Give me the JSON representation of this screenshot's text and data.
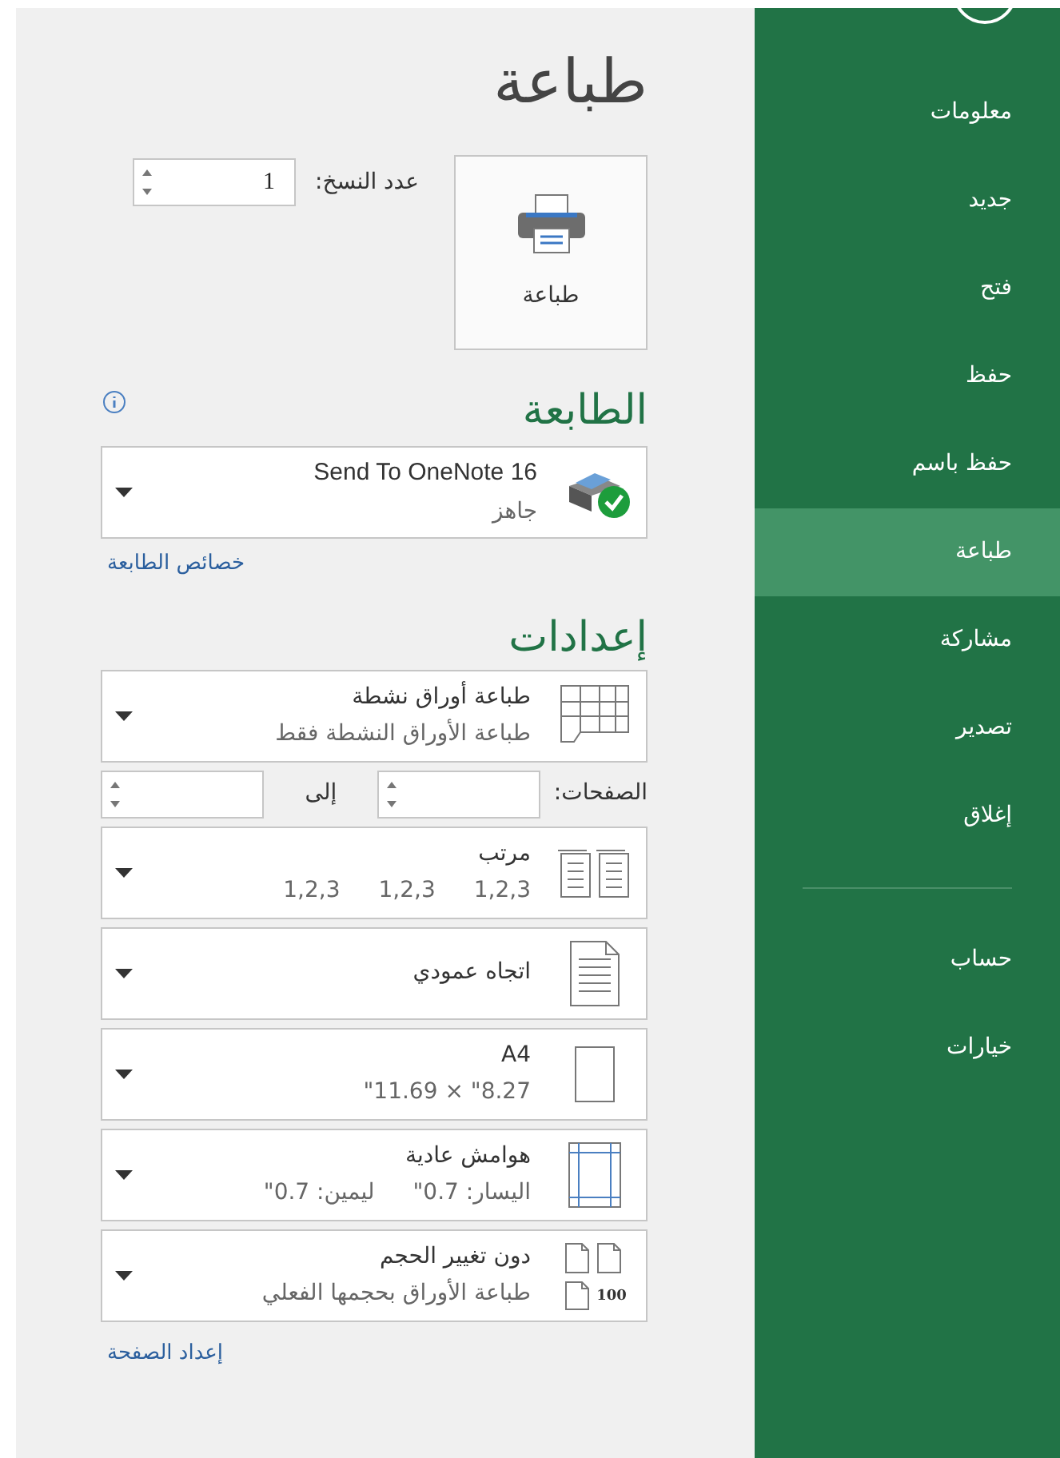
{
  "sidebar": {
    "items": [
      {
        "label": "معلومات",
        "selected": false
      },
      {
        "label": "جديد",
        "selected": false
      },
      {
        "label": "فتح",
        "selected": false
      },
      {
        "label": "حفظ",
        "selected": false
      },
      {
        "label": "حفظ باسم",
        "selected": false
      },
      {
        "label": "طباعة",
        "selected": true
      },
      {
        "label": "مشاركة",
        "selected": false
      },
      {
        "label": "تصدير",
        "selected": false
      },
      {
        "label": "إغلاق",
        "selected": false
      }
    ],
    "bottom_items": [
      {
        "label": "حساب",
        "selected": false
      },
      {
        "label": "خيارات",
        "selected": false
      }
    ]
  },
  "title": "طباعة",
  "print_button": {
    "label": "طباعة"
  },
  "copies": {
    "label": "عدد النسخ:",
    "value": "1"
  },
  "printer": {
    "heading": "الطابعة",
    "name": "Send To OneNote 16",
    "status": "جاهز",
    "link": "خصائص الطابعة"
  },
  "settings": {
    "heading": "إعدادات",
    "link": "إعداد الصفحة",
    "items": [
      {
        "kind": "sheets",
        "title": "طباعة أوراق نشطة",
        "subtitle": "طباعة الأوراق النشطة فقط"
      },
      {
        "kind": "pages",
        "label": "الصفحات:",
        "to_label": "إلى"
      },
      {
        "kind": "collated",
        "title": "مرتب",
        "subtitle_parts": [
          "1,2,3",
          "1,2,3",
          "1,2,3"
        ]
      },
      {
        "kind": "orientation",
        "title": "اتجاه عمودي"
      },
      {
        "kind": "paper",
        "title": "A4",
        "subtitle": "8.27\" × 11.69\""
      },
      {
        "kind": "margins",
        "title": "هوامش عادية",
        "subtitle_parts": [
          "اليسار:  0.7\"",
          "ليمين:  0.7\""
        ]
      },
      {
        "kind": "scaling",
        "icon_label": "100",
        "title": "دون تغيير الحجم",
        "subtitle": "طباعة الأوراق بحجمها الفعلي"
      }
    ]
  }
}
